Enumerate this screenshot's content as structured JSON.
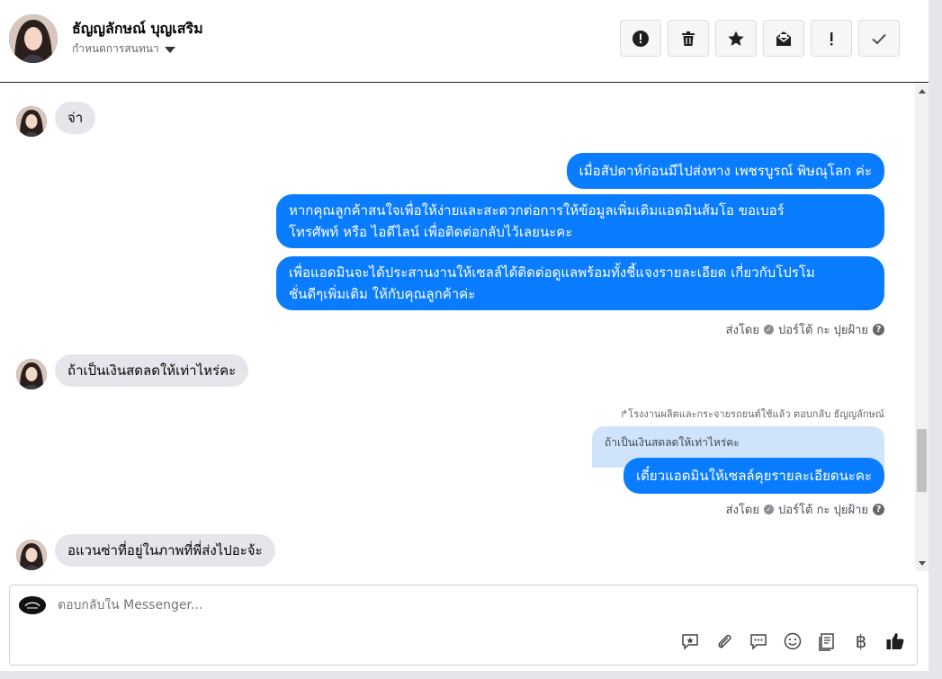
{
  "header": {
    "contact_name": "ธัญญลักษณ์ บุญเสริม",
    "assign_label": "กำหนดการสนทนา",
    "toolbar": [
      {
        "name": "spam-button",
        "icon": "alert-circle-icon"
      },
      {
        "name": "delete-button",
        "icon": "trash-icon"
      },
      {
        "name": "star-button",
        "icon": "star-icon"
      },
      {
        "name": "mark-unread-button",
        "icon": "envelope-icon"
      },
      {
        "name": "important-button",
        "icon": "exclamation-icon"
      },
      {
        "name": "done-button",
        "icon": "check-icon"
      }
    ]
  },
  "messages": {
    "m1": "จ่า",
    "m2": "เมื่อสัปดาห์ก่อนมีไปส่งทาง เพชรบูรณ์  พิษณุโลก ค่ะ",
    "m3_line1": "หากคุณลูกค้าสนใจเพื่อให้ง่ายและสะดวกต่อการให้ข้อมูลเพิ่มเติมแอดมินส้มโอ ขอเบอร์",
    "m3_line2": "โทรศัพท์ หรือ ไอดีไลน์ เพื่อติดต่อกลับไว้เลยนะคะ",
    "m4_line1": "เพื่อแอดมินจะได้ประสานงานให้เซลล์ได้ติดต่อดูแลพร้อมทั้งชี้แจงรายละเอียด เกี่ยวกับโปรโม",
    "m4_line2": "ชั่นดีๆเพิ่มเติม ให้กับคุณลูกค้าค่ะ",
    "sent_by_1": "ส่งโดย",
    "sender_1": "ปอร์โต้ กะ ปุยฝ้าย",
    "m5": "ถ้าเป็นเงินสดลดให้เท่าไหร่คะ",
    "reply_note": "โรงงานผลิตและกระจายรถยนต์ใช้แล้ว ตอบกลับ ธัญญลักษณ์",
    "quoted_text": "ถ้าเป็นเงินสดลดให้เท่าไหร่คะ",
    "m6": "เดี๋ยวแอดมินให้เซลล์คุยรายละเอียดนะคะ",
    "sent_by_2": "ส่งโดย",
    "sender_2": "ปอร์โต้ กะ ปุยฝ้าย",
    "m7": "อแวนซ่าที่อยู่ในภาพที่พี่ส่งไปอะจ้ะ"
  },
  "composer": {
    "placeholder": "ตอบกลับใน Messenger...",
    "tools": [
      "saved-reply-icon",
      "attachment-icon",
      "chat-bubble-icon",
      "emoji-icon",
      "document-icon",
      "baht-icon",
      "thumbs-up-icon"
    ],
    "baht_symbol": "฿"
  },
  "colors": {
    "outgoing_bubble": "#0a7cff",
    "incoming_bubble": "#e4e6eb",
    "quoted_bubble": "#cfe3fb"
  }
}
